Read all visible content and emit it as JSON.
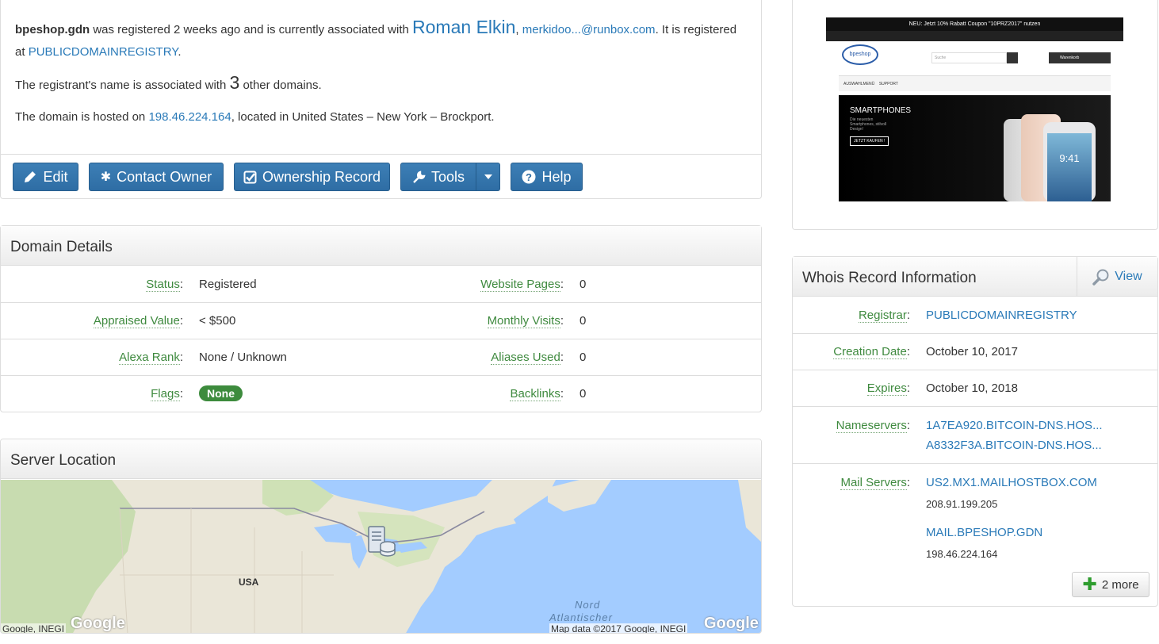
{
  "summary": {
    "domain": "bpeshop.gdn",
    "t1": " was registered 2 weeks ago and is currently associated with ",
    "owner_name": "Roman Elkin",
    "comma": ",",
    "email": "merkidoo...@runbox.com",
    "t2": ". It is registered at ",
    "registrar": "PUBLICDOMAINREGISTRY",
    "period": ".",
    "assoc_pre": "The registrant's name is associated with ",
    "assoc_count": "3",
    "assoc_post": " other domains.",
    "host_pre": "The domain is hosted on ",
    "host_ip": "198.46.224.164",
    "host_post": ", located in United States – New York – Brockport."
  },
  "buttons": {
    "edit": "Edit",
    "contact": "Contact Owner",
    "ownership": "Ownership Record",
    "tools": "Tools",
    "help": "Help"
  },
  "details": {
    "title": "Domain Details",
    "rows": [
      {
        "l1": "Status",
        "v1": "Registered",
        "l2": "Website Pages",
        "v2": "0"
      },
      {
        "l1": "Appraised Value",
        "v1": "< $500",
        "l2": "Monthly Visits",
        "v2": "0"
      },
      {
        "l1": "Alexa Rank",
        "v1": "None / Unknown",
        "l2": "Aliases Used",
        "v2": "0"
      },
      {
        "l1": "Flags",
        "v1": "None",
        "l2": "Backlinks",
        "v2": "0"
      }
    ],
    "colon": ":"
  },
  "server": {
    "title": "Server Location",
    "map_country": "USA",
    "map_ocean": "Nord",
    "map_ocean2": "Atlantischer",
    "attr_left": "Google, INEGI",
    "attr_right": "Map data ©2017 Google, INEGI",
    "google": "Google"
  },
  "screenshot": {
    "banner": "NEU: Jetzt 10% Rabatt Coupon \"10PRZ2017\" nutzen",
    "logo": "bpeshop",
    "search_placeholder": "Suche",
    "cart": "Warenkorb",
    "nav1": "AUSWAHLMENÜ",
    "nav2": "SUPPORT",
    "hero_title": "SMARTPHONES",
    "hero_sub": "Die neuesten Smartphones, stilvoll Design!",
    "hero_btn": "JETZT KAUFEN !",
    "phone_time": "9:41"
  },
  "whois": {
    "title": "Whois Record Information",
    "view": "View",
    "registrar_label": "Registrar",
    "registrar": "PUBLICDOMAINREGISTRY",
    "creation_label": "Creation Date",
    "creation": "October 10, 2017",
    "expires_label": "Expires",
    "expires": "October 10, 2018",
    "ns_label": "Nameservers",
    "ns": [
      "1A7EA920.BITCOIN-DNS.HOS...",
      "A8332F3A.BITCOIN-DNS.HOS..."
    ],
    "mail_label": "Mail Servers",
    "mail": [
      {
        "host": "US2.MX1.MAILHOSTBOX.COM",
        "ip": "208.91.199.205"
      },
      {
        "host": "MAIL.BPESHOP.GDN",
        "ip": "198.46.224.164"
      }
    ],
    "more": "2 more",
    "colon": ":"
  },
  "colors": {
    "accent": "#2a7ab8",
    "button": "#2e6da4",
    "label": "#3f8a3f",
    "badge": "#3d8b3d"
  },
  "icons": [
    "pencil-icon",
    "asterisk-icon",
    "check-square-icon",
    "wrench-icon",
    "caret-down-icon",
    "question-circle-icon",
    "magnifier-icon",
    "plus-icon",
    "server-icon"
  ]
}
